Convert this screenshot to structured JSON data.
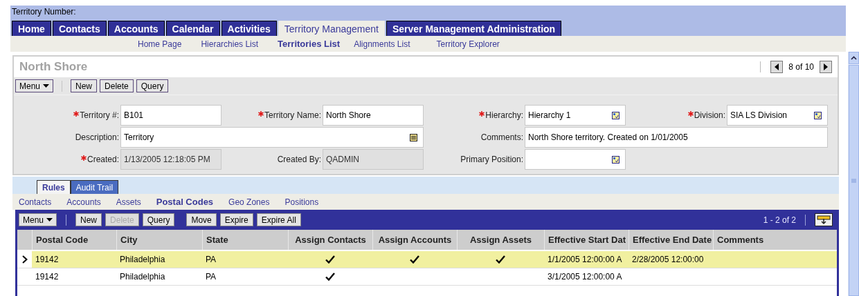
{
  "top_bar": {
    "label": "Territory Number:"
  },
  "main_tabs": [
    {
      "label": "Home",
      "selected": false
    },
    {
      "label": "Contacts",
      "selected": false
    },
    {
      "label": "Accounts",
      "selected": false
    },
    {
      "label": "Calendar",
      "selected": false
    },
    {
      "label": "Activities",
      "selected": false
    },
    {
      "label": "Territory Management",
      "selected": true
    },
    {
      "label": "Server Management Administration",
      "selected": false
    }
  ],
  "sub_nav": [
    {
      "label": "Home Page",
      "selected": false
    },
    {
      "label": "Hierarchies List",
      "selected": false
    },
    {
      "label": "Territories List",
      "selected": true
    },
    {
      "label": "Alignments List",
      "selected": false
    },
    {
      "label": "Territory Explorer",
      "selected": false
    }
  ],
  "form": {
    "title": "North Shore",
    "record_position": "8 of 10",
    "menu": "Menu",
    "buttons": [
      {
        "label": "New",
        "disabled": false
      },
      {
        "label": "Delete",
        "disabled": false
      },
      {
        "label": "Query",
        "disabled": false
      }
    ],
    "fields": [
      {
        "label": "Territory #:",
        "value": "B101",
        "required": true,
        "kind": "text"
      },
      {
        "label": "Territory Name:",
        "value": "North Shore",
        "required": true,
        "kind": "text"
      },
      {
        "label": "Hierarchy:",
        "value": "Hierarchy 1",
        "required": true,
        "kind": "picklist"
      },
      {
        "label": "Division:",
        "value": "SIA LS Division",
        "required": true,
        "kind": "picklist"
      },
      {
        "label": "Description:",
        "value": "Territory",
        "required": false,
        "kind": "note",
        "wide": true
      },
      {
        "label": "Comments:",
        "value": "North Shore territory.  Created on 1/01/2005",
        "required": false,
        "kind": "text",
        "wide": true
      },
      {
        "label": "Created:",
        "value": "1/13/2005 12:18:05 PM",
        "required": true,
        "kind": "readonly"
      },
      {
        "label": "Created By:",
        "value": "QADMIN",
        "required": false,
        "kind": "readonly"
      },
      {
        "label": "Primary Position:",
        "required": false,
        "kind": "picklist"
      }
    ]
  },
  "view_tabs": [
    {
      "label": "Rules",
      "selected": true
    },
    {
      "label": "Audit Trail",
      "selected": false
    }
  ],
  "related_links": [
    {
      "label": "Contacts",
      "selected": false
    },
    {
      "label": "Accounts",
      "selected": false
    },
    {
      "label": "Assets",
      "selected": false
    },
    {
      "label": "Postal Codes",
      "selected": true
    },
    {
      "label": "Geo Zones",
      "selected": false
    },
    {
      "label": "Positions",
      "selected": false
    }
  ],
  "table": {
    "menu": "Menu",
    "buttons": [
      {
        "label": "New",
        "disabled": false
      },
      {
        "label": "Delete",
        "disabled": true
      },
      {
        "label": "Query",
        "disabled": false
      },
      {
        "label": "Move",
        "disabled": false
      },
      {
        "label": "Expire",
        "disabled": false
      },
      {
        "label": "Expire All",
        "disabled": false
      }
    ],
    "record_count": "1 - 2 of 2",
    "columns": [
      {
        "label": "Postal Code",
        "kind": "text"
      },
      {
        "label": "City",
        "kind": "text"
      },
      {
        "label": "State",
        "kind": "text"
      },
      {
        "label": "Assign Contacts",
        "kind": "check"
      },
      {
        "label": "Assign Accounts",
        "kind": "check"
      },
      {
        "label": "Assign Assets",
        "kind": "check"
      },
      {
        "label": "Effective Start Dat",
        "kind": "text"
      },
      {
        "label": "Effective End Date",
        "kind": "text"
      },
      {
        "label": "Comments",
        "kind": "text"
      }
    ],
    "rows": [
      {
        "selected": true,
        "cells": [
          "19142",
          "Philadelphia",
          "PA",
          true,
          true,
          true,
          "1/1/2005 12:00:00 A",
          "2/28/2005 12:00:00",
          ""
        ]
      },
      {
        "selected": false,
        "cells": [
          "19142",
          "Philadelphia",
          "PA",
          true,
          false,
          false,
          "3/1/2005 12:00:00 A",
          "",
          ""
        ]
      }
    ]
  }
}
